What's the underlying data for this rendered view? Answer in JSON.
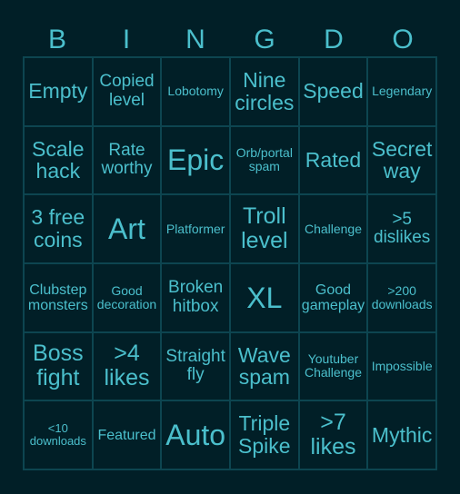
{
  "header": {
    "letters": [
      "B",
      "I",
      "N",
      "G",
      "D",
      "O"
    ]
  },
  "colors": {
    "background": "#011f27",
    "text": "#4bbfcc",
    "grid_line": "#0d4550"
  },
  "board": {
    "rows": [
      [
        "Empty",
        "Copied level",
        "Lobotomy",
        "Nine circles",
        "Speed",
        "Legendary"
      ],
      [
        "Scale hack",
        "Rate worthy",
        "Epic",
        "Orb/portal spam",
        "Rated",
        "Secret way"
      ],
      [
        "3 free coins",
        "Art",
        "Platformer",
        "Troll level",
        "Challenge",
        ">5 dislikes"
      ],
      [
        "Clubstep monsters",
        "Good decoration",
        "Broken hitbox",
        "XL",
        "Good gameplay",
        ">200 downloads"
      ],
      [
        "Boss fight",
        ">4 likes",
        "Straight fly",
        "Wave spam",
        "Youtuber Challenge",
        "Impossible"
      ],
      [
        "<10 downloads",
        "Featured",
        "Auto",
        "Triple Spike",
        ">7 likes",
        "Mythic"
      ]
    ]
  }
}
